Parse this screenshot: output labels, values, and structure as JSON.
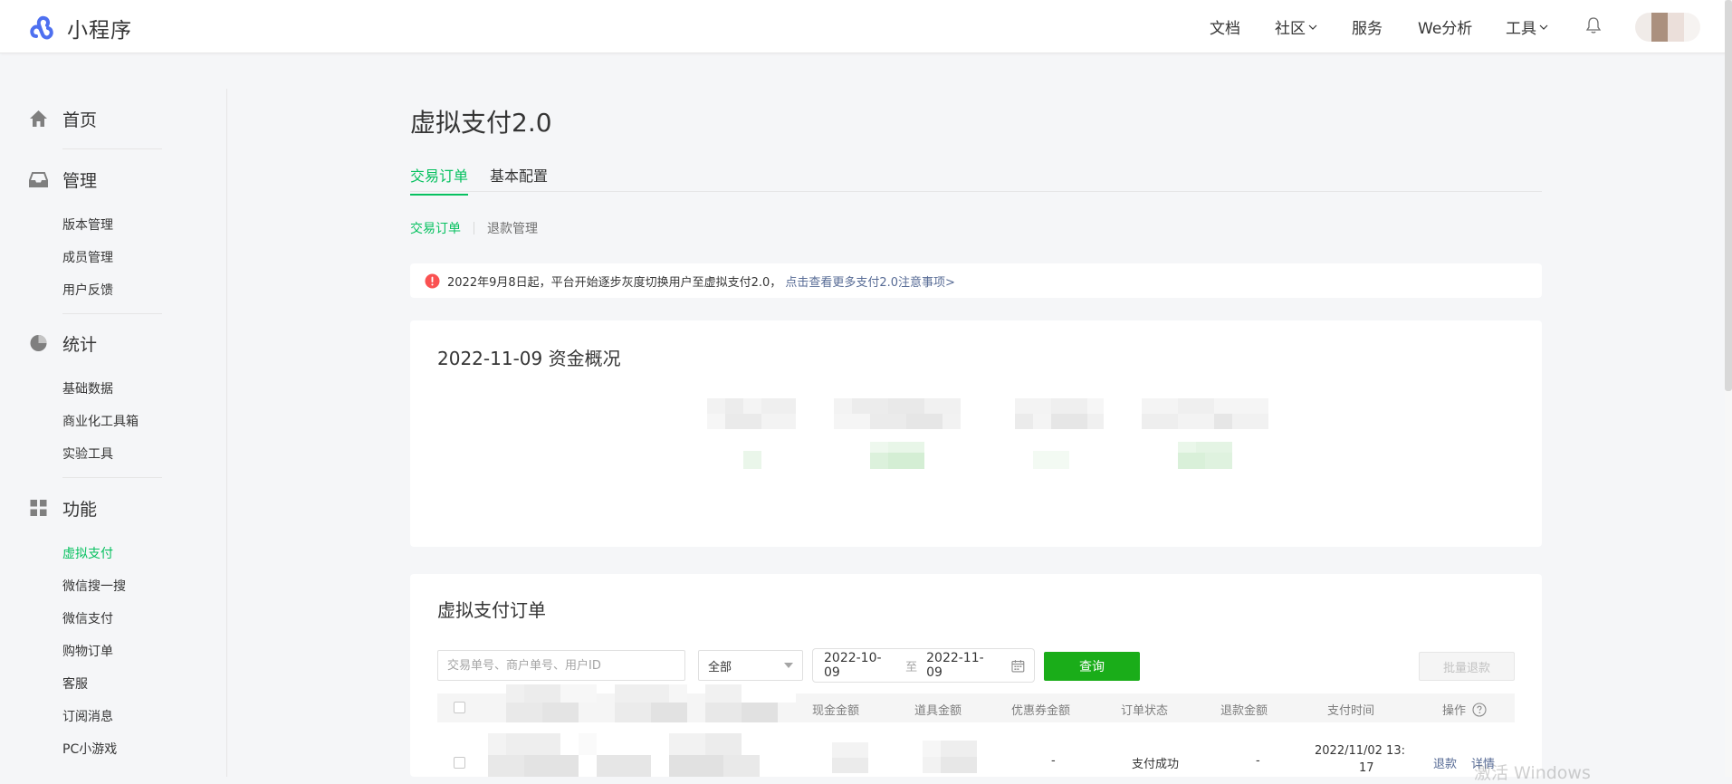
{
  "app": {
    "name": "小程序",
    "brand_color": "#4e70f0",
    "accent_color": "#07c160"
  },
  "topnav": {
    "items": [
      {
        "label": "文档",
        "has_dropdown": false
      },
      {
        "label": "社区",
        "has_dropdown": true
      },
      {
        "label": "服务",
        "has_dropdown": false
      },
      {
        "label": "We分析",
        "has_dropdown": false
      },
      {
        "label": "工具",
        "has_dropdown": true
      }
    ],
    "bell_icon": "bell-icon"
  },
  "sidebar": {
    "sections": [
      {
        "label": "首页",
        "icon": "home-icon",
        "items": []
      },
      {
        "label": "管理",
        "icon": "inbox-icon",
        "items": [
          "版本管理",
          "成员管理",
          "用户反馈"
        ]
      },
      {
        "label": "统计",
        "icon": "pie-chart-icon",
        "items": [
          "基础数据",
          "商业化工具箱",
          "实验工具"
        ]
      },
      {
        "label": "功能",
        "icon": "grid-icon",
        "items": [
          "虚拟支付",
          "微信搜一搜",
          "微信支付",
          "购物订单",
          "客服",
          "订阅消息",
          "PC小游戏"
        ]
      }
    ],
    "active_item": "虚拟支付"
  },
  "page": {
    "title": "虚拟支付2.0",
    "tabs": [
      {
        "label": "交易订单",
        "active": true
      },
      {
        "label": "基本配置",
        "active": false
      }
    ],
    "subtabs": [
      {
        "label": "交易订单",
        "active": true
      },
      {
        "label": "退款管理",
        "active": false
      }
    ],
    "notice": {
      "text": "2022年9月8日起，平台开始逐步灰度切换用户至虚拟支付2.0，",
      "link": "点击查看更多支付2.0注意事项>",
      "icon": "alert-icon"
    }
  },
  "overview": {
    "title": "2022-11-09 资金概况"
  },
  "orders": {
    "title": "虚拟支付订单",
    "search_placeholder": "交易单号、商户单号、用户ID",
    "status_select": "全部",
    "date_start": "2022-10-09",
    "date_sep": "至",
    "date_end": "2022-11-09",
    "query_label": "查询",
    "batch_refund_label": "批量退款",
    "columns": [
      "现金金额",
      "道具金额",
      "优惠券金额",
      "订单状态",
      "退款金额",
      "支付时间",
      "操作"
    ],
    "rows": [
      {
        "coupon_amount": "-",
        "status": "支付成功",
        "refund_amount": "-",
        "pay_time_line1": "2022/11/02 13:",
        "pay_time_line2": "17",
        "action_refund": "退款",
        "action_detail": "详情"
      }
    ]
  },
  "watermark": "激活 Windows"
}
